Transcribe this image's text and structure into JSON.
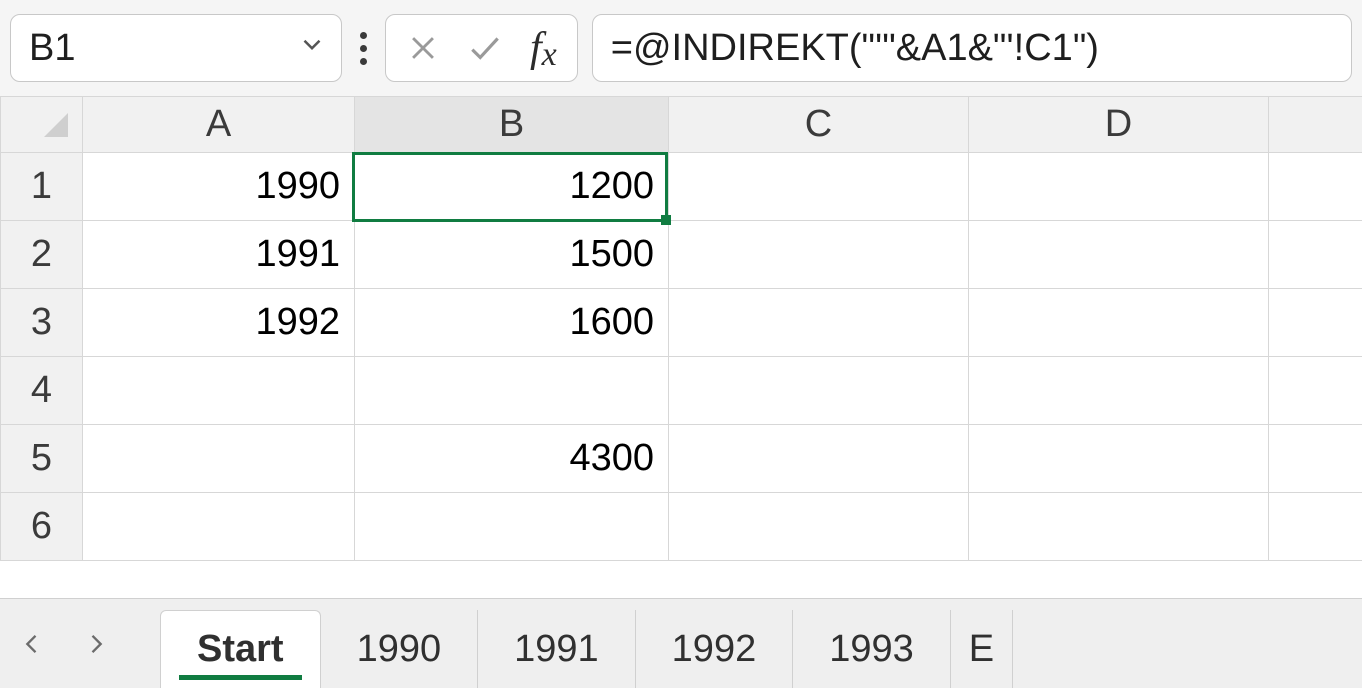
{
  "formula_bar": {
    "cell_reference": "B1",
    "formula": "=@INDIREKT(\"'\"&A1&\"'!C1\")"
  },
  "columns": [
    "A",
    "B",
    "C",
    "D"
  ],
  "rows": [
    "1",
    "2",
    "3",
    "4",
    "5",
    "6"
  ],
  "cells": {
    "A1": "1990",
    "B1": "1200",
    "A2": "1991",
    "B2": "1500",
    "A3": "1992",
    "B3": "1600",
    "B5": "4300"
  },
  "selection": {
    "cell": "B1"
  },
  "sheet_tabs": {
    "active": "Start",
    "tabs": [
      "Start",
      "1990",
      "1991",
      "1992",
      "1993"
    ],
    "overflow_hint": "E"
  }
}
